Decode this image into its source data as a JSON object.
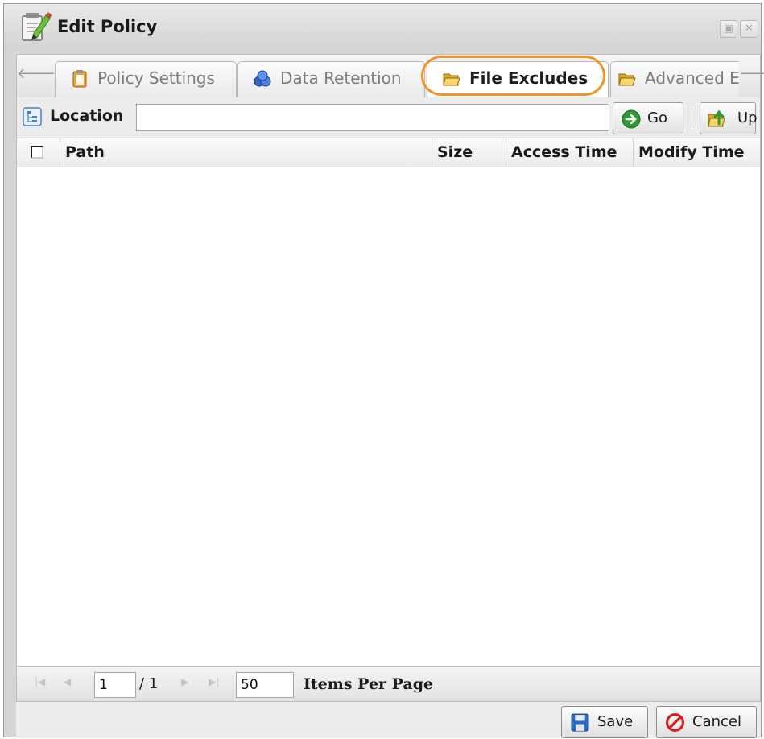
{
  "window": {
    "title": "Edit Policy",
    "title_icon": "edit-document-icon",
    "controls": [
      {
        "name": "restore-icon",
        "glyph": "▣"
      },
      {
        "name": "close-icon",
        "glyph": "✕"
      }
    ]
  },
  "tabs": [
    {
      "label": "Policy Settings",
      "icon": "clipboard-icon",
      "active": false
    },
    {
      "label": "Data Retention",
      "icon": "database-icon",
      "active": false
    },
    {
      "label": "File Excludes",
      "icon": "folder-icon",
      "active": true
    },
    {
      "label": "Advanced E",
      "icon": "folder-icon",
      "active": false
    }
  ],
  "tab_scroll": {
    "left": "🡐",
    "right": "🡒"
  },
  "toolbar": {
    "location_label": "Location",
    "location_value": "",
    "go_label": "Go",
    "up_label": "Up"
  },
  "grid": {
    "columns": [
      "Path",
      "Size",
      "Access Time",
      "Modify Time"
    ],
    "rows": []
  },
  "pager": {
    "page": "1",
    "total_pages": "/ 1",
    "per_page": "50",
    "per_page_label": "Items Per Page"
  },
  "footer": {
    "save_label": "Save",
    "cancel_label": "Cancel"
  },
  "colors": {
    "highlight": "#f0952b",
    "go_icon": "#2f9a2f",
    "cancel_icon": "#d81e1e",
    "save_icon": "#2b6cc4"
  }
}
